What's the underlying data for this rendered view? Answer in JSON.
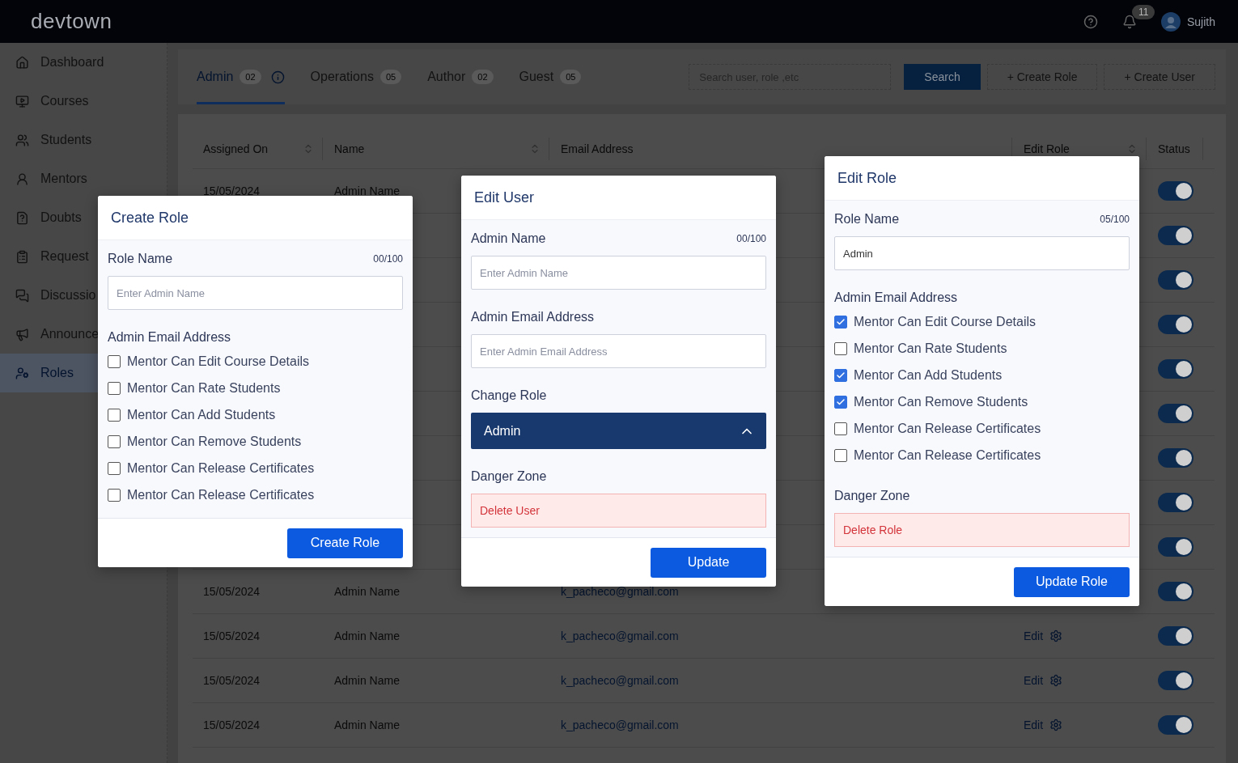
{
  "header": {
    "logo": "devtown",
    "notification_count": "11",
    "user_name": "Sujith"
  },
  "sidebar": {
    "items": [
      {
        "kind": "dashboard",
        "label": "Dashboard",
        "selected": false
      },
      {
        "kind": "courses",
        "label": "Courses",
        "selected": false
      },
      {
        "kind": "students",
        "label": "Students",
        "selected": false
      },
      {
        "kind": "mentors",
        "label": "Mentors",
        "selected": false
      },
      {
        "kind": "doubts",
        "label": "Doubts",
        "selected": false
      },
      {
        "kind": "request",
        "label": "Request",
        "selected": false
      },
      {
        "kind": "discussion",
        "label": "Discussio",
        "selected": false
      },
      {
        "kind": "announce",
        "label": "Announce",
        "selected": false
      },
      {
        "kind": "roles",
        "label": "Roles",
        "selected": true
      }
    ]
  },
  "tabs": [
    {
      "label": "Admin",
      "count": "02",
      "selected": true,
      "info": true
    },
    {
      "label": "Operations",
      "count": "05",
      "selected": false,
      "info": false
    },
    {
      "label": "Author",
      "count": "02",
      "selected": false,
      "info": false
    },
    {
      "label": "Guest",
      "count": "05",
      "selected": false,
      "info": false
    }
  ],
  "search": {
    "placeholder": "Search user, role ,etc"
  },
  "toolbar_buttons": [
    {
      "kind": "primary",
      "label": "Search"
    },
    {
      "kind": "outline",
      "label": "+ Create Role"
    },
    {
      "kind": "outline",
      "label": "+ Create User"
    }
  ],
  "table": {
    "columns": [
      {
        "label": "Assigned On",
        "sortable": true
      },
      {
        "label": "Name",
        "sortable": true
      },
      {
        "label": "Email Address",
        "sortable": false
      },
      {
        "label": "Edit Role",
        "sortable": true
      },
      {
        "label": "Status",
        "sortable": false
      }
    ],
    "rows": [
      {
        "date": "15/05/2024",
        "name": "Admin Name",
        "status_on": true
      },
      {
        "status_on": true
      },
      {
        "status_on": true
      },
      {
        "status_on": true
      },
      {
        "status_on": true
      },
      {
        "status_on": true
      },
      {
        "status_on": true
      },
      {
        "status_on": true
      },
      {
        "status_on": true
      },
      {
        "date": "15/05/2024",
        "name": "Admin Name",
        "email": "k_pacheco@gmail.com",
        "status_on": true
      },
      {
        "date": "15/05/2024",
        "name": "Admin Name",
        "email": "k_pacheco@gmail.com",
        "edit": "Edit",
        "status_on": true
      },
      {
        "date": "15/05/2024",
        "name": "Admin Name",
        "email": "k_pacheco@gmail.com",
        "edit": "Edit",
        "status_on": true
      },
      {
        "date": "15/05/2024",
        "name": "Admin Name",
        "email": "k_pacheco@gmail.com",
        "edit": "Edit",
        "status_on": true
      }
    ]
  },
  "dialogs": [
    {
      "title": "Create Role",
      "submit": "Create Role",
      "sections": [
        {
          "kind": "text_field",
          "label": "Role Name",
          "counter": "00/100",
          "placeholder": "Enter Admin Name"
        },
        {
          "kind": "checklist",
          "label": "Admin Email Address",
          "options": [
            {
              "label": "Mentor Can Edit Course Details",
              "checked": false
            },
            {
              "label": "Mentor Can Rate Students",
              "checked": false
            },
            {
              "label": "Mentor Can Add Students",
              "checked": false
            },
            {
              "label": "Mentor Can Remove Students",
              "checked": false
            },
            {
              "label": "Mentor Can Release Certificates",
              "checked": false
            },
            {
              "label": "Mentor Can Release Certificates",
              "checked": false
            }
          ]
        }
      ]
    },
    {
      "title": "Edit User",
      "submit": "Update",
      "sections": [
        {
          "kind": "text_field",
          "label": "Admin Name",
          "counter": "00/100",
          "placeholder": "Enter Admin Name"
        },
        {
          "kind": "text_field",
          "label": "Admin Email Address",
          "placeholder": "Enter Admin Email Address"
        },
        {
          "kind": "select",
          "label": "Change Role",
          "value": "Admin",
          "expanded": true
        },
        {
          "kind": "danger",
          "label": "Danger Zone",
          "action": "Delete User"
        }
      ]
    },
    {
      "title": "Edit Role",
      "submit": "Update Role",
      "sections": [
        {
          "kind": "text_field",
          "label": "Role Name",
          "counter": "05/100",
          "value": "Admin"
        },
        {
          "kind": "checklist",
          "label": "Admin Email Address",
          "options": [
            {
              "label": "Mentor Can Edit Course Details",
              "checked": true
            },
            {
              "label": "Mentor Can Rate Students",
              "checked": false
            },
            {
              "label": "Mentor Can Add Students",
              "checked": true
            },
            {
              "label": "Mentor Can Remove Students",
              "checked": true
            },
            {
              "label": "Mentor Can Release Certificates",
              "checked": false
            },
            {
              "label": "Mentor Can Release Certificates",
              "checked": false
            }
          ]
        },
        {
          "kind": "danger",
          "label": "Danger Zone",
          "action": "Delete Role"
        }
      ]
    }
  ]
}
